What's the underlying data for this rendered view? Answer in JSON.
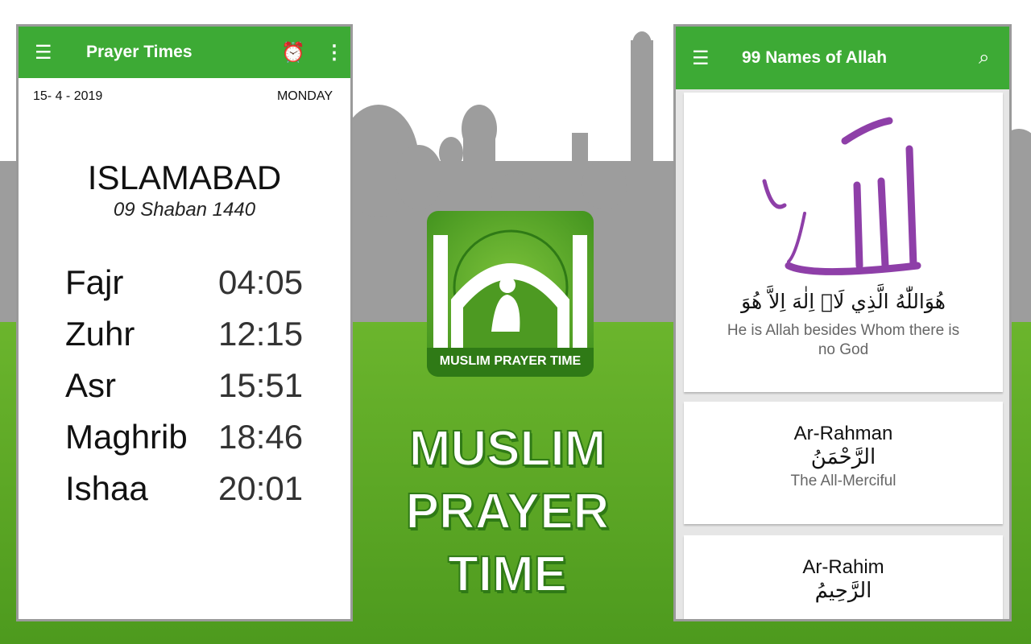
{
  "colors": {
    "app_bar": "#3daa35",
    "background_green": "#5aa524",
    "calligraphy": "#8e3fa8"
  },
  "prayer_app": {
    "title": "Prayer Times",
    "icons": [
      "menu-icon",
      "alarm-icon",
      "more-vert-icon"
    ],
    "date": "15- 4 - 2019",
    "day": "MONDAY",
    "city": "ISLAMABAD",
    "hijri_date": "09 Shaban 1440",
    "prayers": [
      {
        "name": "Fajr",
        "time": "04:05"
      },
      {
        "name": "Zuhr",
        "time": "12:15"
      },
      {
        "name": "Asr",
        "time": "15:51"
      },
      {
        "name": "Maghrib",
        "time": "18:46"
      },
      {
        "name": "Ishaa",
        "time": "20:01"
      }
    ]
  },
  "logo": {
    "label": "MUSLIM PRAYER TIME"
  },
  "headline": {
    "line1": "MUSLIM",
    "line2": "PRAYER",
    "line3": "TIME"
  },
  "names_app": {
    "title": "99 Names of Allah",
    "icons": [
      "menu-icon",
      "search-icon"
    ],
    "intro": {
      "arabic": "هُوَاللّٰهُ الَّذِي لَاۤ اِلٰهَ اِلاَّ هُوَ",
      "translation": "He is Allah besides Whom there is no God"
    },
    "names": [
      {
        "name": "Ar-Rahman",
        "arabic": "الرَّحْمَنُ",
        "meaning": "The All-Merciful"
      },
      {
        "name": "Ar-Rahim",
        "arabic": "الرَّحِيمُ",
        "meaning": ""
      }
    ]
  }
}
